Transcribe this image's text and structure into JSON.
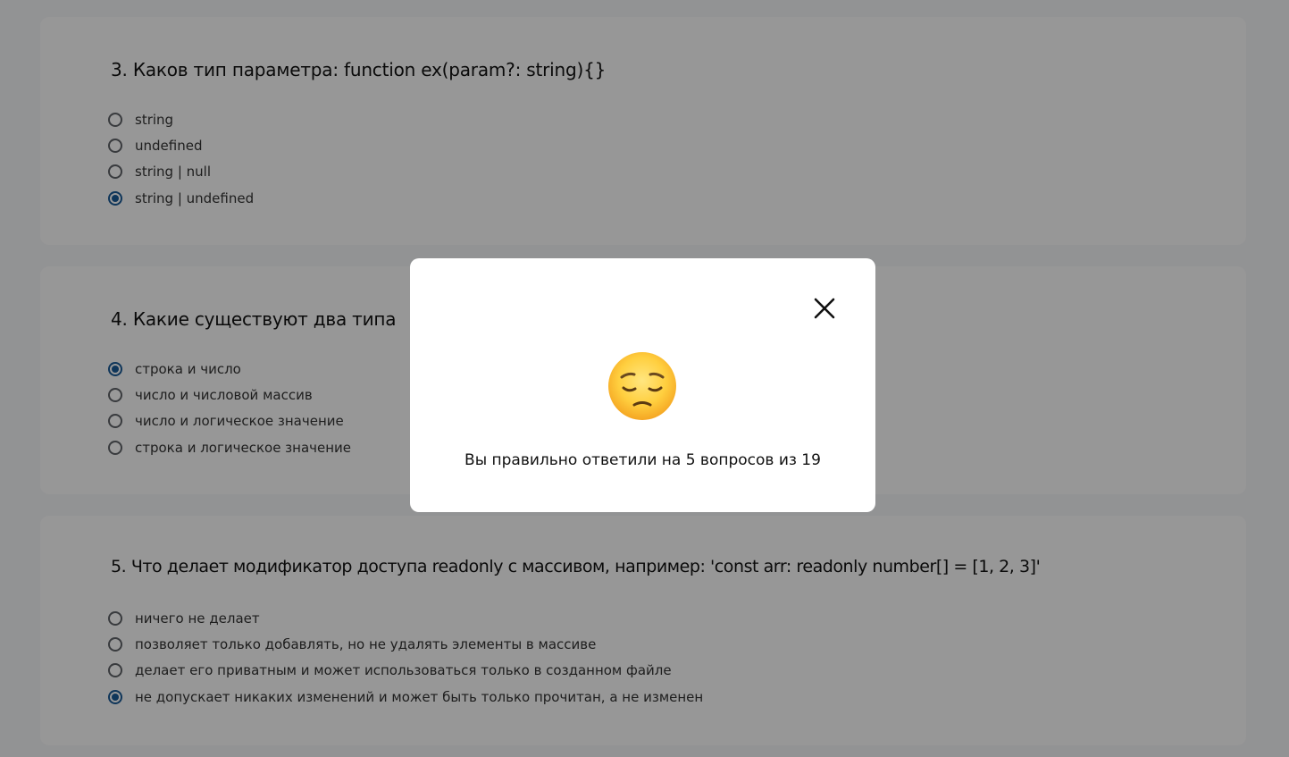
{
  "questions": [
    {
      "title": "3. Каков тип параметра: function ex(param?: string){}",
      "options": [
        {
          "label": "string",
          "checked": false
        },
        {
          "label": "undefined",
          "checked": false
        },
        {
          "label": "string | null",
          "checked": false
        },
        {
          "label": "string | undefined",
          "checked": true
        }
      ]
    },
    {
      "title": "4. Какие существуют два типа",
      "options": [
        {
          "label": "строка и число",
          "checked": true
        },
        {
          "label": "число и числовой массив",
          "checked": false
        },
        {
          "label": "число и логическое значение",
          "checked": false
        },
        {
          "label": "строка и логическое значение",
          "checked": false
        }
      ]
    },
    {
      "title": "5. Что делает модификатор доступа readonly с массивом, например: 'const arr: readonly number[] = [1, 2, 3]'",
      "options": [
        {
          "label": "ничего не делает",
          "checked": false
        },
        {
          "label": "позволяет только добавлять, но не удалять элементы в массиве",
          "checked": false
        },
        {
          "label": "делает его приватным и может использоваться только в созданном файле",
          "checked": false
        },
        {
          "label": "не допускает никаких изменений и может быть только прочитан, а не изменен",
          "checked": true
        }
      ]
    }
  ],
  "modal": {
    "emoji": "pensive-face",
    "result_text": "Вы правильно ответили на 5 вопросов из 19",
    "close_icon": "close-icon"
  },
  "colors": {
    "page_background": "#f4f5f7",
    "card_background": "#fcfcfc",
    "radio_checked": "#1a5a96",
    "radio_border": "#5f6368",
    "overlay": "rgba(0,0,0,0.4)",
    "modal_background": "#ffffff"
  }
}
